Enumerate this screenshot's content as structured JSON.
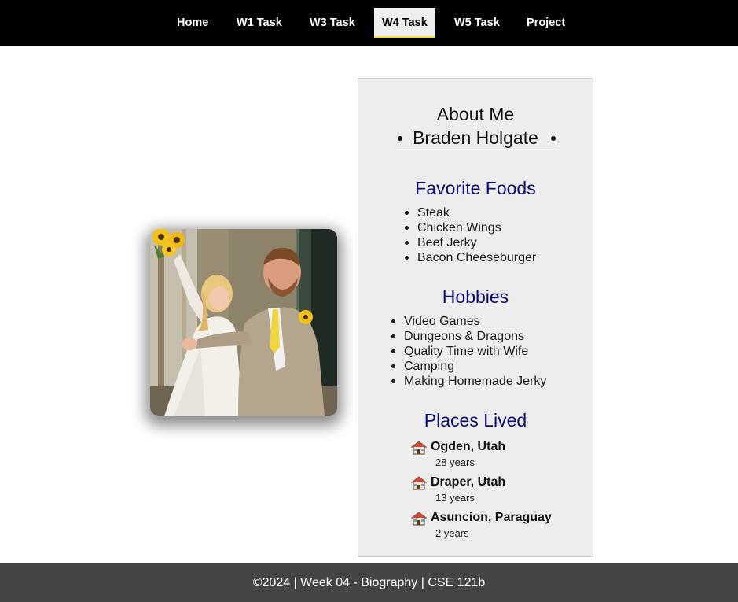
{
  "nav": {
    "items": [
      {
        "label": "Home"
      },
      {
        "label": "W1 Task"
      },
      {
        "label": "W3 Task"
      },
      {
        "label": "W4 Task",
        "active": true
      },
      {
        "label": "W5 Task"
      },
      {
        "label": "Project"
      }
    ],
    "active_highlight_color": "#f5e04a"
  },
  "photo": {
    "icon": "wedding-photo"
  },
  "about": {
    "title": "About Me",
    "name": "Braden Holgate",
    "favorite_foods": {
      "heading": "Favorite Foods",
      "items": [
        "Steak",
        "Chicken Wings",
        "Beef Jerky",
        "Bacon Cheeseburger"
      ]
    },
    "hobbies": {
      "heading": "Hobbies",
      "items": [
        "Video Games",
        "Dungeons & Dragons",
        "Quality Time with Wife",
        "Camping",
        "Making Homemade Jerky"
      ]
    },
    "places": {
      "heading": "Places Lived",
      "icon": "house-icon",
      "items": [
        {
          "name": "Ogden, Utah",
          "years": "28 years"
        },
        {
          "name": "Draper, Utah",
          "years": "13 years"
        },
        {
          "name": "Asuncion, Paraguay",
          "years": "2 years"
        }
      ]
    },
    "heading_color": "#0b0b6e"
  },
  "footer": {
    "text": "©2024 | Week 04 - Biography | CSE 121b"
  }
}
